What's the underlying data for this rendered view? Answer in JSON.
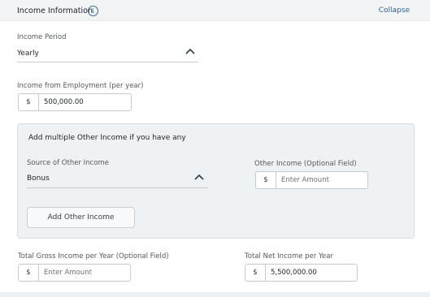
{
  "header": {
    "title": "Income Information",
    "info_icon": "info-icon",
    "collapse_label": "Collapse"
  },
  "income_period": {
    "label": "Income Period",
    "value": "Yearly",
    "chevron": "chevron-up-icon"
  },
  "employment_income": {
    "label": "Income from Employment (per year)",
    "currency": "$",
    "value": "500,000.00"
  },
  "other_income_panel": {
    "title": "Add multiple Other Income if you have any",
    "source": {
      "label": "Source of Other Income",
      "value": "Bonus",
      "chevron": "chevron-up-icon"
    },
    "amount": {
      "label": "Other Income (Optional Field)",
      "currency": "$",
      "placeholder": "Enter Amount"
    },
    "add_button_label": "Add Other Income"
  },
  "total_gross": {
    "label": "Total Gross Income per Year (Optional Field)",
    "currency": "$",
    "placeholder": "Enter Amount"
  },
  "total_net": {
    "label": "Total Net Income per Year",
    "currency": "$",
    "value": "5,500,000.00"
  },
  "colors": {
    "accent": "#2a6496",
    "panel_bg": "#eef2f5",
    "header_bg": "#f2f4f6"
  }
}
